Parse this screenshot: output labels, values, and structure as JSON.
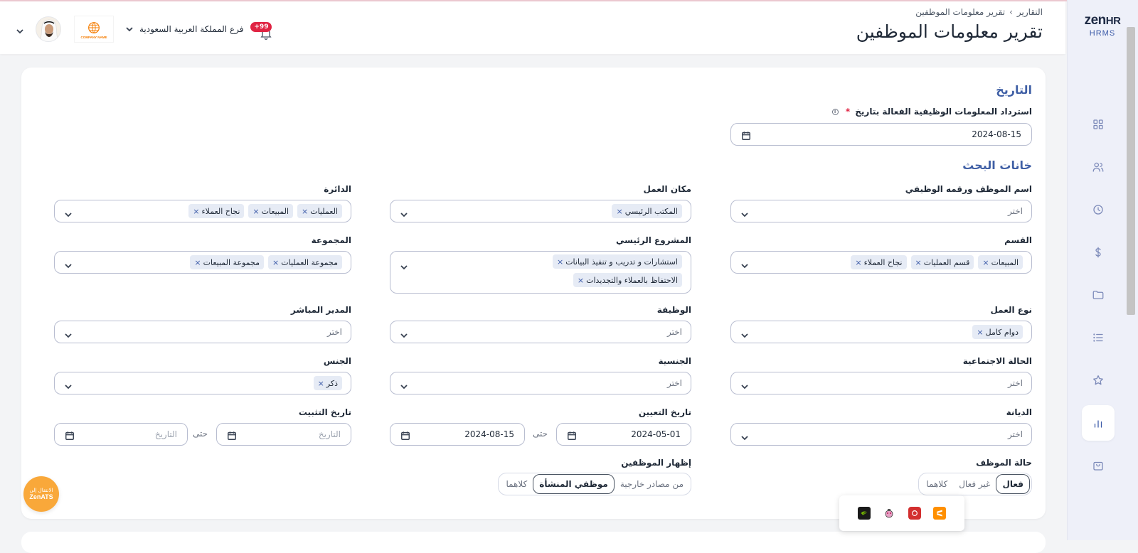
{
  "app": {
    "logo_main": "zen",
    "logo_hr": "HR",
    "logo_sub": "HRMS"
  },
  "header": {
    "breadcrumb": [
      "التقارير",
      "تقرير معلومات الموظفين"
    ],
    "title": "تقرير معلومات الموظفين",
    "branch": "فرع المملكة العربية السعودية",
    "notifications_badge": "+99",
    "company_logo_text": "COMPANY NAME"
  },
  "sidebar": {
    "items": [
      {
        "icon": "grid-icon"
      },
      {
        "icon": "users-icon"
      },
      {
        "icon": "clock-icon"
      },
      {
        "icon": "dollar-icon"
      },
      {
        "icon": "folder-icon"
      },
      {
        "icon": "list-icon"
      },
      {
        "icon": "star-icon"
      },
      {
        "icon": "bar-chart-icon",
        "active": true
      },
      {
        "icon": "bag-icon"
      }
    ]
  },
  "form": {
    "date_section": {
      "title": "التاريخ",
      "label": "استرداد المعلومات الوظيفية الفعالة بتاريخ",
      "required_mark": "*",
      "value": "2024-08-15"
    },
    "search_section_title": "خانات البحث",
    "placeholder": "اختر",
    "date_placeholder": "التاريخ",
    "until": "حتى",
    "employee": {
      "label": "اسم الموظف ورقمه الوظيفي"
    },
    "workplace": {
      "label": "مكان العمل",
      "tags": [
        "المكتب الرئيسي"
      ]
    },
    "directorate": {
      "label": "الدائرة",
      "tags": [
        "العمليات",
        "المبيعات",
        "نجاح العملاء"
      ]
    },
    "department": {
      "label": "القسم",
      "tags": [
        "المبيعات",
        "قسم العمليات",
        "نجاح العملاء"
      ]
    },
    "main_project": {
      "label": "المشروع الرئيسي",
      "tags": [
        "استشارات و تدريب و تنفيذ البيانات",
        "الاحتفاظ بالعملاء والتجديدات"
      ]
    },
    "group": {
      "label": "المجموعة",
      "tags": [
        "مجموعة العمليات",
        "مجموعة المبيعات"
      ]
    },
    "work_type": {
      "label": "نوع العمل",
      "tags": [
        "دوام كامل"
      ]
    },
    "job": {
      "label": "الوظيفة"
    },
    "manager": {
      "label": "المدير المباشر"
    },
    "marital": {
      "label": "الحالة الاجتماعية"
    },
    "nationality": {
      "label": "الجنسية"
    },
    "gender": {
      "label": "الجنس",
      "tags": [
        "ذكر"
      ]
    },
    "religion": {
      "label": "الديانة"
    },
    "hire_date": {
      "label": "تاريخ التعيين",
      "from": "2024-05-01",
      "to": "2024-08-15"
    },
    "confirm_date": {
      "label": "تاريخ التثبيت"
    },
    "employee_status": {
      "label": "حالة الموظف",
      "options": [
        "فعال",
        "غير فعال",
        "كلاهما"
      ],
      "selected": 0
    },
    "show_employees": {
      "label": "إظهار الموظفين",
      "options": [
        "من مصادر خارجية",
        "موظفي المنشأة",
        "كلاهما"
      ],
      "selected": 1
    }
  },
  "zenats": {
    "line1": "الانتقال إلى",
    "line2": "ZenATS"
  },
  "taskbar": {
    "icons": [
      "nvidia-icon",
      "game-controller-icon",
      "red-app-icon",
      "sublime-icon"
    ]
  },
  "colors": {
    "accent": "#3f5fa5",
    "badge": "#e02443",
    "zenats": "#f9a83a",
    "tag_bg": "#e6ebf5"
  }
}
